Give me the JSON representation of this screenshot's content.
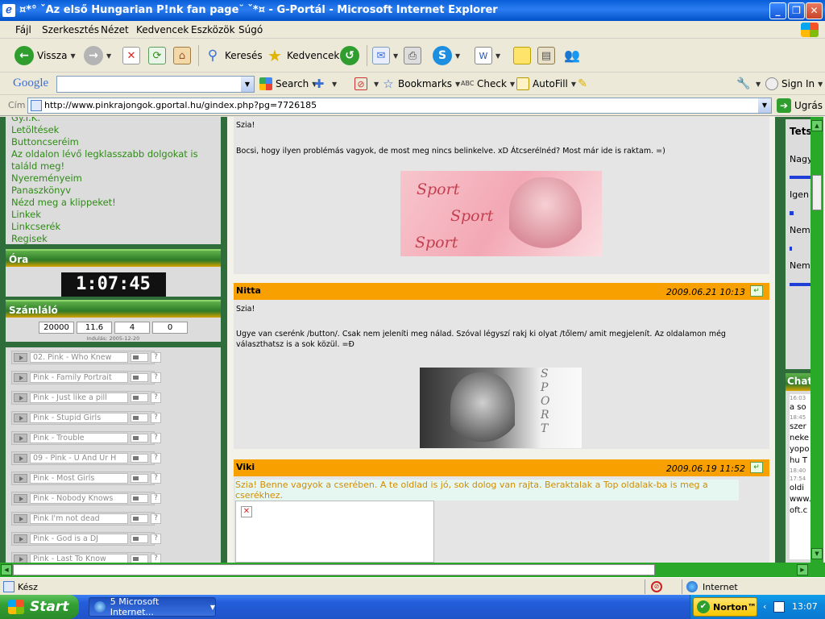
{
  "window": {
    "title": "¤*° ˇAz első Hungarian P!nk fan page˘ ˇ*¤ - G-Portál - Microsoft Internet Explorer",
    "min_label": "_",
    "max_label": "❐",
    "close_label": "✕"
  },
  "menu": [
    "Fájl",
    "Szerkesztés",
    "Nézet",
    "Kedvencek",
    "Eszközök",
    "Súgó"
  ],
  "toolbar": {
    "back_label": "Vissza",
    "search_label": "Keresés",
    "favorites_label": "Kedvencek"
  },
  "google": {
    "logo": "Google",
    "search_label": "Search",
    "bookmarks_label": "Bookmarks",
    "check_label": "Check",
    "autofill_label": "AutoFill",
    "signin_label": "Sign In"
  },
  "address": {
    "label": "Cím",
    "url": "http://www.pinkrajongok.gportal.hu/gindex.php?pg=7726185",
    "go_label": "Ugrás"
  },
  "sidebar": {
    "nav": [
      "Gy.I.K.",
      "Letöltések",
      "Buttoncseréim",
      "Az oldalon lévő legklasszabb dolgokat is",
      "találd meg!",
      "Nyereményeim",
      "Panaszkönyv",
      "Nézd meg a klippeket!",
      "Linkek",
      "Linkcserék",
      "Regisek"
    ],
    "clock_title": "Óra",
    "clock_time": "1:07:45",
    "counter_title": "Számláló",
    "counter_values": [
      "20000",
      "11.6",
      "4",
      "0"
    ],
    "counter_since": "Indulás: 2005-12-20",
    "tracks": [
      "02. Pink - Who Knew",
      "Pink - Family Portrait",
      "Pink - Just like a pill",
      "Pink - Stupid Girls",
      "Pink - Trouble",
      "09 - Pink - U And Ur H",
      "Pink - Most Girls",
      "Pink - Nobody Knows",
      "Pink I'm not dead",
      "Pink - God is a DJ",
      "Pink - Last To Know"
    ],
    "help_label": "?"
  },
  "posts": [
    {
      "greeting": "Szia!",
      "text": "Bocsi, hogy ilyen problémás vagyok, de most meg nincs belinkelve. xD Átcserélnéd? Most már ide is raktam. =)",
      "banner_words": [
        "Sport",
        "Sport",
        "Sport"
      ]
    },
    {
      "author": "Nitta",
      "date": "2009.06.21 10:13",
      "greeting": "Szia!",
      "text": "Ugye van cserénk /button/. Csak nem jeleníti meg nálad. Szóval légyszí rakj ki olyat /tőlem/ amit megjelenít. Az oldalamon még választhatsz is a sok közül. =Đ",
      "banner_word": "SPORT"
    },
    {
      "author": "Viki",
      "date": "2009.06.19 11:52",
      "text": "Szia! Benne vagyok a cserében. A te oldlad is jó, sok dolog van rajta. Beraktalak a Top oldalak-ba is meg a cserékhez."
    }
  ],
  "rightcol": {
    "poll_title": "Tets",
    "poll_options": [
      "Nagy",
      "Igen",
      "Nem",
      "Nem"
    ],
    "chat_title": "Chat",
    "chat_lines": [
      "16:03",
      "a so",
      "18:45",
      "szer",
      "neke",
      "yopo",
      "hu T",
      "18:40",
      "17:54",
      "oldi",
      "www.",
      "oft.c"
    ]
  },
  "status": {
    "text": "Kész",
    "zone": "Internet"
  },
  "taskbar": {
    "start": "Start",
    "task": "5 Microsoft Internet...",
    "norton": "Norton™",
    "time": "13:07"
  },
  "colors": {
    "post_header": "#f7a000",
    "sidebar_bg": "#2f6d3a",
    "link_green": "#2e8b16"
  }
}
